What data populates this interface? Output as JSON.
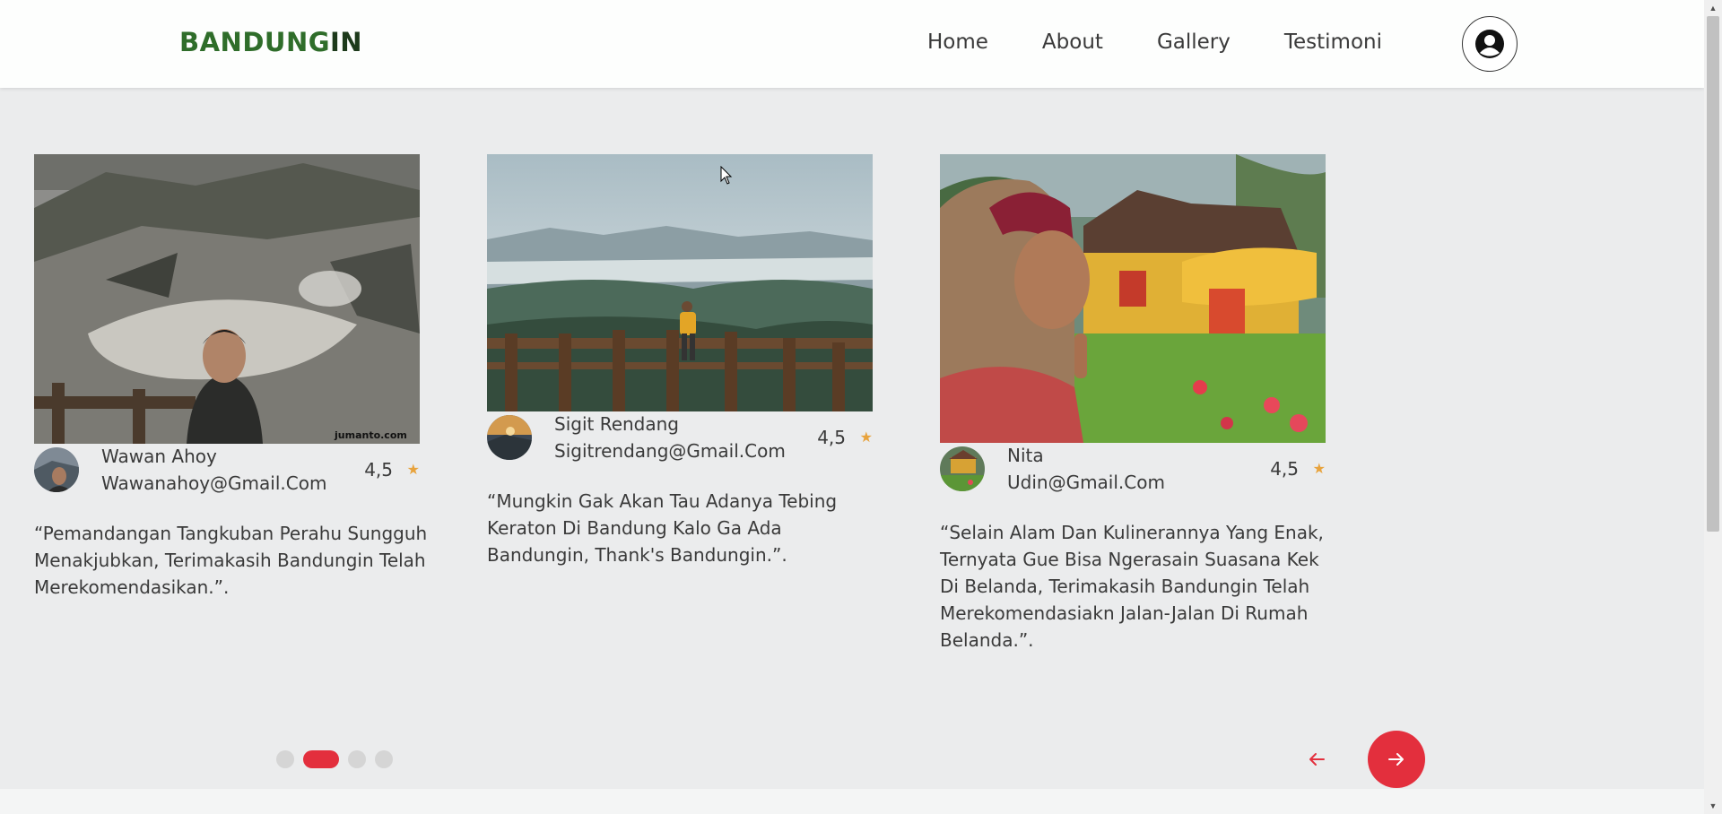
{
  "header": {
    "logo_green": "BANDUNG",
    "logo_dark": "IN",
    "nav": [
      "Home",
      "About",
      "Gallery",
      "Testimoni"
    ],
    "user_icon": "user-circle-icon"
  },
  "testimonials": [
    {
      "name": "Wawan Ahoy",
      "email": "Wawanahoy@Gmail.Com",
      "rating": "4,5",
      "star": "★",
      "quote": "“Pemandangan Tangkuban Perahu Sungguh Menakjubkan, Terimakasih Bandungin Telah Merekomendasikan.”.",
      "watermark": "jumanto.com"
    },
    {
      "name": "Sigit Rendang",
      "email": "Sigitrendang@Gmail.Com",
      "rating": "4,5",
      "star": "★",
      "quote": "“Mungkin Gak Akan Tau Adanya Tebing Keraton Di Bandung Kalo Ga Ada Bandungin, Thank's Bandungin.”."
    },
    {
      "name": "Nita",
      "email": "Udin@Gmail.Com",
      "rating": "4,5",
      "star": "★",
      "quote": "“Selain Alam Dan Kulinerannya Yang Enak, Ternyata Gue Bisa Ngerasain Suasana Kek Di Belanda, Terimakasih Bandungin Telah Merekomendasiakn Jalan-Jalan Di Rumah Belanda.”."
    }
  ],
  "carousel": {
    "total_slides": 4,
    "active_slide": 2,
    "prev_icon": "arrow-left-icon",
    "next_icon": "arrow-right-icon"
  },
  "colors": {
    "brand_green": "#2f6d2a",
    "accent_red": "#e32f3d",
    "star": "#e8a33d",
    "background": "#ebeced"
  }
}
